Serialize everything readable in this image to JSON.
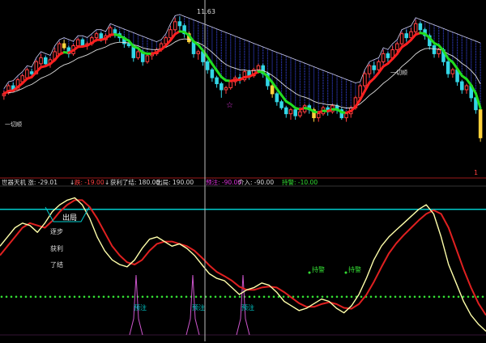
{
  "colors": {
    "background": "#000000",
    "bull_candle": "#ff4040",
    "bear_candle": "#33d6e6",
    "signal_candle": "#ffd23a",
    "ma_up": "#ff2020",
    "ma_down": "#22dd22",
    "ma_slow": "#dddddd",
    "cloud": "#4050ff",
    "separator": "#9a1a1a",
    "cursor": "#bbbbbb",
    "osc_fast": "#ffffaa",
    "osc_slow": "#e02020",
    "upper_band": "#00cccc",
    "dotted_level": "#33dd33",
    "impulse": "#cc55cc",
    "label_magenta": "#dd33dd"
  },
  "top_panel": {
    "price_high_label": "11.63",
    "trend_labels": [
      "一切顺",
      "一切顺"
    ],
    "right_marker": "1"
  },
  "indicator_header": {
    "items": [
      {
        "text": "世器天机 涨: -29.01",
        "color": "#dddddd"
      },
      {
        "text": "↓",
        "color": "#dddddd"
      },
      {
        "text": "跌: -19.00",
        "color": "#ff4040"
      },
      {
        "text": "↓",
        "color": "#dddddd"
      },
      {
        "text": "获利了结: 180.00",
        "color": "#dddddd"
      },
      {
        "text": "出局: 190.00",
        "color": "#dddddd"
      },
      {
        "text": "预注: -90.00",
        "color": "#dd33dd"
      },
      {
        "text": "介入: -90.00",
        "color": "#dddddd"
      },
      {
        "text": "持警: -10.00",
        "color": "#33dd33"
      }
    ]
  },
  "annotations": {
    "exit_label": "出局",
    "steps": [
      "逐步",
      "获利",
      "了结"
    ],
    "alert_labels": [
      "持警",
      "持警"
    ],
    "pre_labels": [
      "预注",
      "预注",
      "预注"
    ]
  },
  "chart_data": [
    {
      "type": "candlestick",
      "title": "",
      "ylim": [
        8.0,
        11.8
      ],
      "candles": [
        [
          9.65,
          9.7,
          9.55,
          9.78
        ],
        [
          9.72,
          9.9,
          9.68,
          9.95
        ],
        [
          9.9,
          9.8,
          9.75,
          9.98
        ],
        [
          9.8,
          10.05,
          9.78,
          10.1
        ],
        [
          10.0,
          10.15,
          9.95,
          10.2
        ],
        [
          10.1,
          10.3,
          10.05,
          10.35
        ],
        [
          10.25,
          10.2,
          10.1,
          10.32
        ],
        [
          10.2,
          10.5,
          10.18,
          10.55
        ],
        [
          10.45,
          10.6,
          10.4,
          10.7
        ],
        [
          10.6,
          10.45,
          10.4,
          10.65
        ],
        [
          10.45,
          10.55,
          10.35,
          10.6
        ],
        [
          10.55,
          10.75,
          10.5,
          10.85
        ],
        [
          10.7,
          10.95,
          10.65,
          11.0
        ],
        [
          10.95,
          10.85,
          10.8,
          11.05
        ],
        [
          10.85,
          10.7,
          10.6,
          10.9
        ],
        [
          10.7,
          10.9,
          10.65,
          10.95
        ],
        [
          10.9,
          11.05,
          10.85,
          11.1
        ],
        [
          11.05,
          10.9,
          10.85,
          11.1
        ],
        [
          10.9,
          10.95,
          10.8,
          11.0
        ],
        [
          10.95,
          11.1,
          10.9,
          11.15
        ],
        [
          11.1,
          11.2,
          11.0,
          11.25
        ],
        [
          11.2,
          11.05,
          11.0,
          11.25
        ],
        [
          11.05,
          11.15,
          10.95,
          11.2
        ],
        [
          11.15,
          11.35,
          11.1,
          11.4
        ],
        [
          11.3,
          11.2,
          11.1,
          11.35
        ],
        [
          11.2,
          11.1,
          11.0,
          11.25
        ],
        [
          11.1,
          10.95,
          10.85,
          11.15
        ],
        [
          10.95,
          10.9,
          10.85,
          11.0
        ],
        [
          10.9,
          10.6,
          10.5,
          10.95
        ],
        [
          10.6,
          10.75,
          10.55,
          10.8
        ],
        [
          10.75,
          10.5,
          10.4,
          10.8
        ],
        [
          10.5,
          10.65,
          10.45,
          10.7
        ],
        [
          10.65,
          10.7,
          10.55,
          10.75
        ],
        [
          10.7,
          10.8,
          10.65,
          10.85
        ],
        [
          10.8,
          10.95,
          10.75,
          11.0
        ],
        [
          10.95,
          11.1,
          10.9,
          11.15
        ],
        [
          11.1,
          11.3,
          11.05,
          11.4
        ],
        [
          11.3,
          11.5,
          11.25,
          11.6
        ],
        [
          11.5,
          11.4,
          11.3,
          11.63
        ],
        [
          11.4,
          11.2,
          11.1,
          11.45
        ],
        [
          11.2,
          11.0,
          10.95,
          11.25
        ],
        [
          11.0,
          10.7,
          10.6,
          11.05
        ],
        [
          10.7,
          10.75,
          10.55,
          10.8
        ],
        [
          10.75,
          10.5,
          10.4,
          10.8
        ],
        [
          10.5,
          10.3,
          10.2,
          10.55
        ],
        [
          10.3,
          10.1,
          10.0,
          10.35
        ],
        [
          10.1,
          9.95,
          9.85,
          10.15
        ],
        [
          9.95,
          9.8,
          9.6,
          10.0
        ],
        [
          9.8,
          9.85,
          9.7,
          9.9
        ],
        [
          9.85,
          10.0,
          9.8,
          10.05
        ],
        [
          10.0,
          10.1,
          9.9,
          10.15
        ],
        [
          10.1,
          10.05,
          9.95,
          10.2
        ],
        [
          10.05,
          10.25,
          10.0,
          10.3
        ],
        [
          10.25,
          10.15,
          10.05,
          10.3
        ],
        [
          10.15,
          10.3,
          10.1,
          10.35
        ],
        [
          10.3,
          10.4,
          10.2,
          10.45
        ],
        [
          10.4,
          10.2,
          10.1,
          10.45
        ],
        [
          10.2,
          9.9,
          9.8,
          10.25
        ],
        [
          9.9,
          9.7,
          9.6,
          9.95
        ],
        [
          9.7,
          9.5,
          9.4,
          9.75
        ],
        [
          9.5,
          9.35,
          9.3,
          9.55
        ],
        [
          9.35,
          9.2,
          9.1,
          9.4
        ],
        [
          9.2,
          9.3,
          9.05,
          9.35
        ],
        [
          9.3,
          9.15,
          9.05,
          9.35
        ],
        [
          9.15,
          9.25,
          9.1,
          9.3
        ],
        [
          9.25,
          9.4,
          9.2,
          9.45
        ],
        [
          9.4,
          9.3,
          9.2,
          9.45
        ],
        [
          9.3,
          9.1,
          9.0,
          9.35
        ],
        [
          9.1,
          9.2,
          9.0,
          9.25
        ],
        [
          9.2,
          9.35,
          9.15,
          9.4
        ],
        [
          9.35,
          9.25,
          9.15,
          9.4
        ],
        [
          9.25,
          9.4,
          9.2,
          9.45
        ],
        [
          9.4,
          9.3,
          9.2,
          9.45
        ],
        [
          9.3,
          9.1,
          9.05,
          9.35
        ],
        [
          9.1,
          9.2,
          9.0,
          9.25
        ],
        [
          9.2,
          9.35,
          9.1,
          9.4
        ],
        [
          9.35,
          9.6,
          9.3,
          9.65
        ],
        [
          9.6,
          9.9,
          9.55,
          9.95
        ],
        [
          9.9,
          10.2,
          9.85,
          10.25
        ],
        [
          10.2,
          10.4,
          10.1,
          10.45
        ],
        [
          10.4,
          10.3,
          10.2,
          10.5
        ],
        [
          10.3,
          10.5,
          10.25,
          10.55
        ],
        [
          10.5,
          10.7,
          10.45,
          10.8
        ],
        [
          10.7,
          10.6,
          10.5,
          10.75
        ],
        [
          10.6,
          10.8,
          10.55,
          10.9
        ],
        [
          10.8,
          10.95,
          10.7,
          11.0
        ],
        [
          10.95,
          11.2,
          10.9,
          11.25
        ],
        [
          11.2,
          11.1,
          11.0,
          11.3
        ],
        [
          11.1,
          11.25,
          11.05,
          11.35
        ],
        [
          11.25,
          11.45,
          11.2,
          11.55
        ],
        [
          11.45,
          11.3,
          11.2,
          11.5
        ],
        [
          11.3,
          11.15,
          11.05,
          11.35
        ],
        [
          11.15,
          10.9,
          10.8,
          11.2
        ],
        [
          10.9,
          10.7,
          10.6,
          10.95
        ],
        [
          10.7,
          10.8,
          10.6,
          10.85
        ],
        [
          10.8,
          10.5,
          10.4,
          10.85
        ],
        [
          10.5,
          10.2,
          10.1,
          10.55
        ],
        [
          10.2,
          10.3,
          10.1,
          10.35
        ],
        [
          10.3,
          10.0,
          9.9,
          10.35
        ],
        [
          10.0,
          9.8,
          9.7,
          10.05
        ],
        [
          9.8,
          9.9,
          9.7,
          9.95
        ],
        [
          9.9,
          9.6,
          9.5,
          9.95
        ],
        [
          9.6,
          9.3,
          9.2,
          9.65
        ],
        [
          9.3,
          8.6,
          8.5,
          9.35
        ]
      ],
      "cursor_index": 38
    },
    {
      "type": "line",
      "title": "",
      "ylim": [
        -100,
        220
      ],
      "levels": {
        "upper": 180,
        "dotted": -10
      },
      "series": [
        {
          "role": "fast",
          "values": [
            100,
            120,
            140,
            150,
            145,
            130,
            150,
            175,
            190,
            200,
            205,
            190,
            160,
            120,
            90,
            70,
            60,
            55,
            70,
            95,
            115,
            120,
            110,
            100,
            105,
            95,
            80,
            60,
            40,
            30,
            25,
            10,
            -5,
            5,
            10,
            20,
            15,
            0,
            -20,
            -30,
            -40,
            -35,
            -25,
            -15,
            -20,
            -35,
            -45,
            -30,
            -5,
            30,
            70,
            100,
            120,
            135,
            150,
            165,
            180,
            190,
            170,
            120,
            60,
            20,
            -20,
            -50,
            -70,
            -85
          ]
        },
        {
          "role": "slow",
          "values": [
            80,
            100,
            120,
            140,
            150,
            145,
            140,
            155,
            175,
            190,
            200,
            200,
            185,
            160,
            130,
            100,
            80,
            65,
            60,
            70,
            90,
            105,
            110,
            110,
            105,
            100,
            90,
            75,
            58,
            44,
            35,
            25,
            12,
            5,
            5,
            10,
            12,
            10,
            0,
            -12,
            -24,
            -32,
            -32,
            -26,
            -22,
            -26,
            -34,
            -36,
            -26,
            -6,
            22,
            54,
            84,
            106,
            124,
            140,
            156,
            170,
            178,
            170,
            140,
            95,
            50,
            10,
            -25,
            -50
          ]
        },
        {
          "role": "impulse",
          "values": [
            0,
            0,
            0,
            0,
            0,
            0,
            0,
            0,
            0,
            0,
            0,
            0,
            0,
            0,
            0,
            0,
            0,
            0,
            0,
            0,
            0,
            0,
            0,
            0,
            0,
            0,
            0,
            0,
            0,
            0,
            0,
            0,
            0,
            0,
            0,
            0,
            0,
            0,
            0,
            0,
            0,
            0,
            0,
            0,
            0,
            0,
            0,
            0,
            0,
            0,
            0,
            0,
            0,
            0,
            0,
            0,
            0,
            0,
            0,
            0,
            0,
            0,
            0,
            0,
            0,
            0
          ]
        }
      ]
    }
  ]
}
